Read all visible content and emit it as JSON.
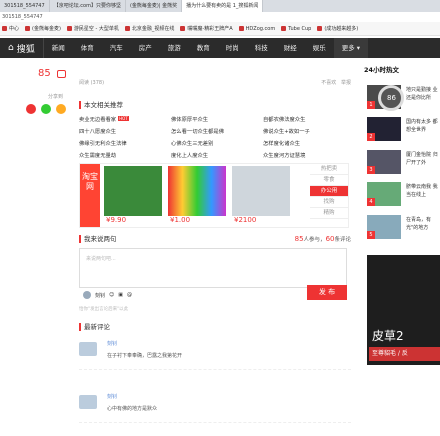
{
  "browser": {
    "tabs": [
      {
        "label": "301518_554747",
        "active": false
      },
      {
        "label": "【京吧论坛.com】只要你够坚",
        "active": false
      },
      {
        "label": "(金熊每金麦)| 金熊奖",
        "active": false
      },
      {
        "label": "播为什么要有卖的是 1_搜狐新闻",
        "active": true
      }
    ],
    "address": "301518_554747",
    "bookmarks": [
      "中心",
      "(金熊每金麦)",
      "游民星空 - 大型单机",
      "北京金融_视频在线",
      "嘴嘴魔-精彩王牌产A",
      "HDZog.com",
      "Tube Cup",
      "(成功越来越多)"
    ]
  },
  "nav": {
    "logo": "搜狐",
    "items": [
      "新闻",
      "体育",
      "汽车",
      "房产",
      "旅游",
      "教育",
      "时尚",
      "科技",
      "财经",
      "娱乐"
    ],
    "more": "更多"
  },
  "left": {
    "comment_count": "85",
    "share_label": "分享到"
  },
  "article": {
    "read_label": "阅读 (378)",
    "not_interested": "不喜欢",
    "report": "举报"
  },
  "related": {
    "title": "本文相关推荐",
    "items": [
      {
        "text": "卖业无边看看家",
        "hot": true
      },
      {
        "text": "佛体原厚平众生"
      },
      {
        "text": "自都农佛法度众生"
      },
      {
        "text": "四十八愿度众生"
      },
      {
        "text": "怎么看一切众生都是佛"
      },
      {
        "text": "佛说众生+故如一子"
      },
      {
        "text": "佛缘引无利众生法律"
      },
      {
        "text": "心佛众生三无差别"
      },
      {
        "text": "怎样度化诸众生"
      },
      {
        "text": "众生需度无量劫"
      },
      {
        "text": "度化上人度众生"
      },
      {
        "text": "众生度河方证慧境"
      }
    ]
  },
  "ad": {
    "brand": "淘宝网",
    "prices": [
      "¥9.90",
      "¥1.00",
      "¥2100"
    ],
    "tabs": [
      "热把卖",
      "零食",
      "办公用",
      "找购",
      "精购"
    ]
  },
  "comments": {
    "title": "我来说两句",
    "participants": "85",
    "participants_suffix": "人参与，",
    "count": "60",
    "count_suffix": "条评论",
    "placeholder": "来说两句吧...",
    "username": "刻钊",
    "post_button": "发 布",
    "note": "恰你\"发出言论后来\"以此",
    "latest_title": "最新评论",
    "list": [
      {
        "name": "刻钊",
        "text": "在子衬下奉奉确，巴露之我第花开"
      },
      {
        "name": "刻钊",
        "text": "心中有佛的地方是默众"
      }
    ]
  },
  "hot24": {
    "title": "24小时热文",
    "items": [
      {
        "text": "地只是勤接 业还是你比所",
        "rank": "1"
      },
      {
        "text": "国内有太多 都想全世界",
        "rank": "2"
      },
      {
        "text": "厦门金怡院 归尸开了外",
        "rank": "3"
      },
      {
        "text": "脐带云南我 我当在线上",
        "rank": "4"
      },
      {
        "text": "在青岛，有 光\"的地方",
        "rank": "5"
      }
    ],
    "popup_value": "86",
    "promo_line1": "皮草2",
    "promo_line2": "至尊貂毛 / 反"
  }
}
